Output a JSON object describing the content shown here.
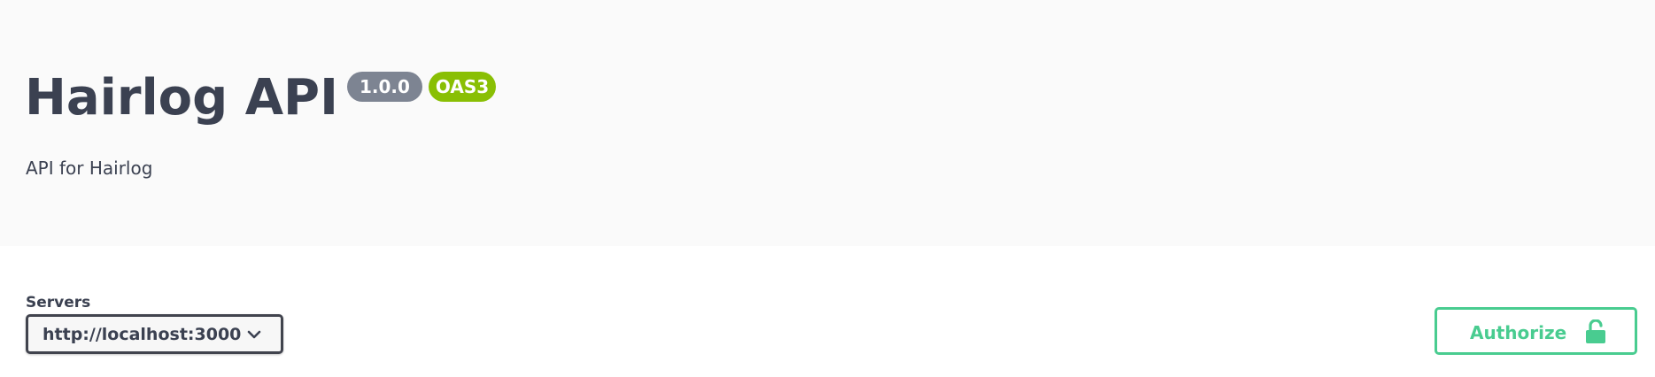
{
  "info": {
    "title": "Hairlog API",
    "version": "1.0.0",
    "spec_badge": "OAS3",
    "description": "API for Hairlog"
  },
  "servers": {
    "label": "Servers",
    "selected": "http://localhost:3000",
    "chevron_icon": "chevron-down-icon"
  },
  "authorize": {
    "label": "Authorize",
    "icon": "unlocked-icon"
  },
  "colors": {
    "info_background": "#fafafa",
    "text": "#3b4151",
    "version_badge": "#7d8492",
    "oas_badge": "#89bf04",
    "authorize_accent": "#49cc90",
    "select_border": "#41444e"
  }
}
